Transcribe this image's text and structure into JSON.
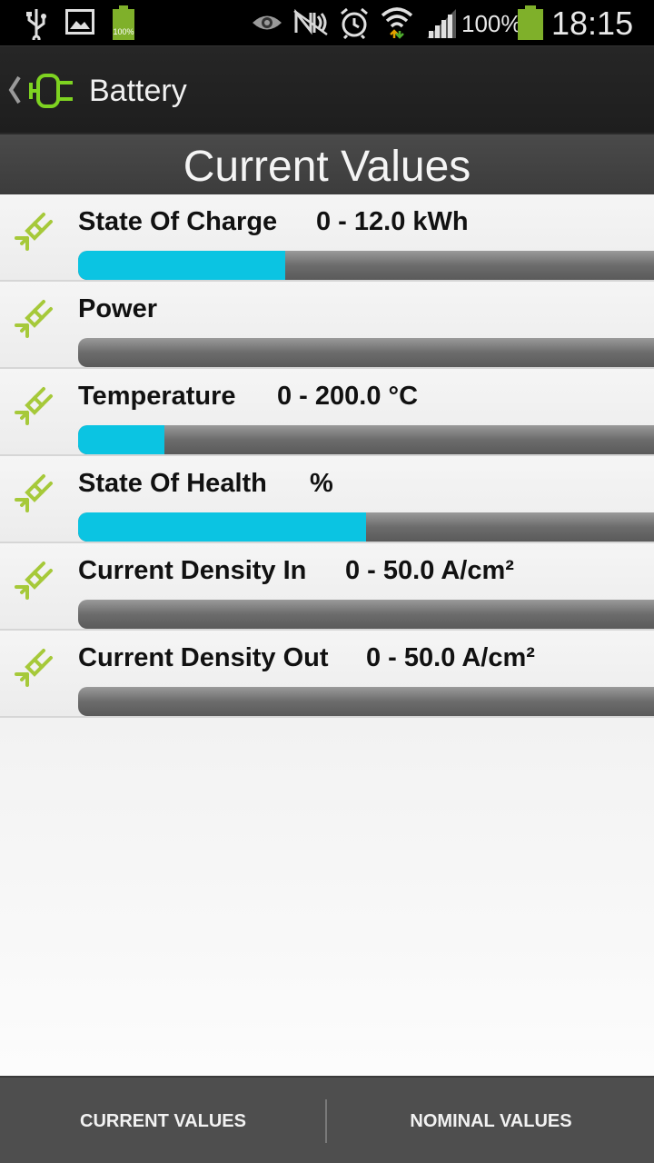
{
  "status_bar": {
    "battery_small_label": "100%",
    "signal_percent": "100%",
    "time": "18:15",
    "icons": [
      "usb-icon",
      "image-icon",
      "battery-small-icon",
      "eye-icon",
      "nfc-icon",
      "alarm-icon",
      "wifi-icon",
      "signal-icon",
      "battery-icon"
    ]
  },
  "action_bar": {
    "title": "Battery",
    "icon": "battery-plug-icon"
  },
  "header": {
    "title": "Current Values"
  },
  "rows": [
    {
      "label": "State Of Charge",
      "range": "0 - 12.0 kWh",
      "level": 0.36
    },
    {
      "label": "Power",
      "range": "",
      "level": 0
    },
    {
      "label": "Temperature",
      "range": "0 - 200.0 °C",
      "level": 0.15
    },
    {
      "label": "State Of Health",
      "range": "%",
      "level": 0.5
    },
    {
      "label": "Current Density In",
      "range": "0 - 50.0 A/cm²",
      "level": 0
    },
    {
      "label": "Current Density Out",
      "range": "0 - 50.0 A/cm²",
      "level": 0
    }
  ],
  "tabs": {
    "current": "CURRENT VALUES",
    "nominal": "NOMINAL VALUES"
  },
  "colors": {
    "accent": "#0bc4e2",
    "plug": "#a6c93a",
    "app_icon": "#7ed321"
  }
}
